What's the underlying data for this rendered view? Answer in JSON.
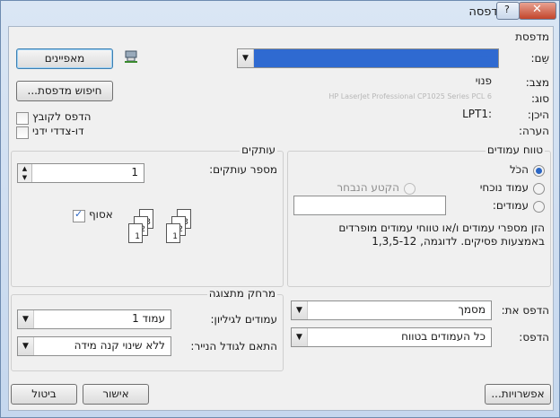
{
  "window": {
    "title": "הדפסה"
  },
  "printer": {
    "section_title": "מדפסת",
    "name_label": "שֵם:",
    "name_value": "HP LaserJet Professional CP1025 Series PCL 6",
    "properties_button": "מאפיינים",
    "status_label": "מצב:",
    "status_value": "פנוי",
    "type_label": "סוג:",
    "type_value": "HP LaserJet Professional CP1025 Series PCL 6",
    "where_label": "היכן:",
    "where_value": "LPT1:",
    "comment_label": "הערה:",
    "find_button": "חיפוש מדפסת...",
    "print_to_file": "הדפס לקובץ",
    "duplex": "דו-צדדי ידני"
  },
  "page_range": {
    "title": "טווח עמודים",
    "all": "הכֹל",
    "current": "עמוד נוכחי",
    "selection": "הקטע הנבחר",
    "pages": "עמודים:",
    "hint": "הזן מספרי עמודים ו/או טווחי עמודים מופרדים באמצעות פסיקים. לדוגמה, 1,3,5-12"
  },
  "copies": {
    "title": "עותקים",
    "number_label": "מספר עותקים:",
    "number_value": "1",
    "collate": "אסוף",
    "page_numbers": [
      "1",
      "2",
      "3",
      "1",
      "2",
      "3"
    ]
  },
  "print_what": {
    "label": "הדפס את:",
    "value": "מסמך"
  },
  "print_scope": {
    "label": "הדפס:",
    "value": "כל העמודים בטווח"
  },
  "zoom": {
    "title": "מרחק מתצוגה",
    "pages_per_sheet_label": "עמודים לגיליון:",
    "pages_per_sheet_value": "עמוד 1",
    "scale_label": "התאם לגודל הנייר:",
    "scale_value": "ללא שינוי קנה מידה"
  },
  "footer": {
    "options": "אפשרויות...",
    "ok": "אישור",
    "cancel": "ביטול"
  }
}
